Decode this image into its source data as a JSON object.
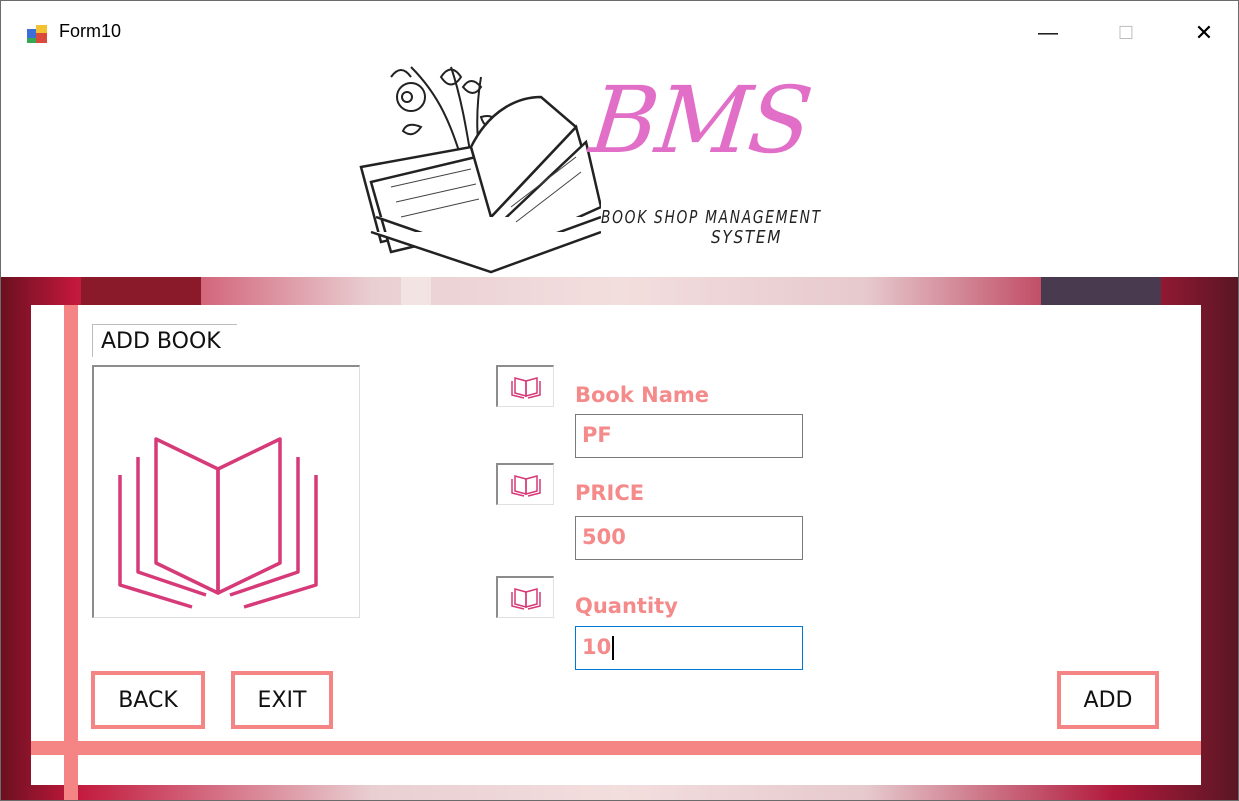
{
  "window": {
    "title": "Form10",
    "controls": {
      "minimize": "—",
      "maximize": "☐",
      "close": "✕"
    }
  },
  "header": {
    "brand": "BMS",
    "tagline_line1": "BOOK SHOP MANAGEMENT",
    "tagline_line2": "SYSTEM"
  },
  "form": {
    "group_title": "ADD BOOK",
    "fields": [
      {
        "label": "Book Name",
        "value": "PF"
      },
      {
        "label": "PRICE",
        "value": "500"
      },
      {
        "label": "Quantity",
        "value": "10"
      }
    ],
    "buttons": {
      "back": "BACK",
      "exit": "EXIT",
      "add": "ADD"
    }
  },
  "colors": {
    "accent": "#f58484",
    "label_text": "#f48a8a",
    "brand_pink": "#e16fc8",
    "icon_pink": "#d63a78",
    "focus_border": "#0078d7"
  }
}
